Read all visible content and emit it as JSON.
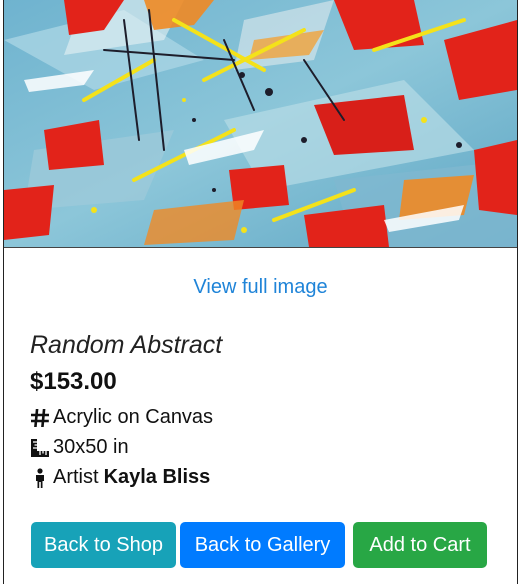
{
  "artwork": {
    "image_alt": "abstract painting"
  },
  "view_full_image": "View full image",
  "product": {
    "title": "Random Abstract",
    "price": "$153.00",
    "medium": "Acrylic on Canvas",
    "size": "30x50 in",
    "artist_label": "Artist",
    "artist_name": "Kayla Bliss"
  },
  "icons": {
    "medium": "hashtag-icon",
    "size": "ruler-icon",
    "artist": "person-icon"
  },
  "buttons": {
    "back_to_shop": "Back to Shop",
    "back_to_gallery": "Back to Gallery",
    "add_to_cart": "Add to Cart"
  },
  "colors": {
    "link": "#1f84d8",
    "shop_button": "#17a2b8",
    "gallery_button": "#007bff",
    "cart_button": "#28a745"
  }
}
